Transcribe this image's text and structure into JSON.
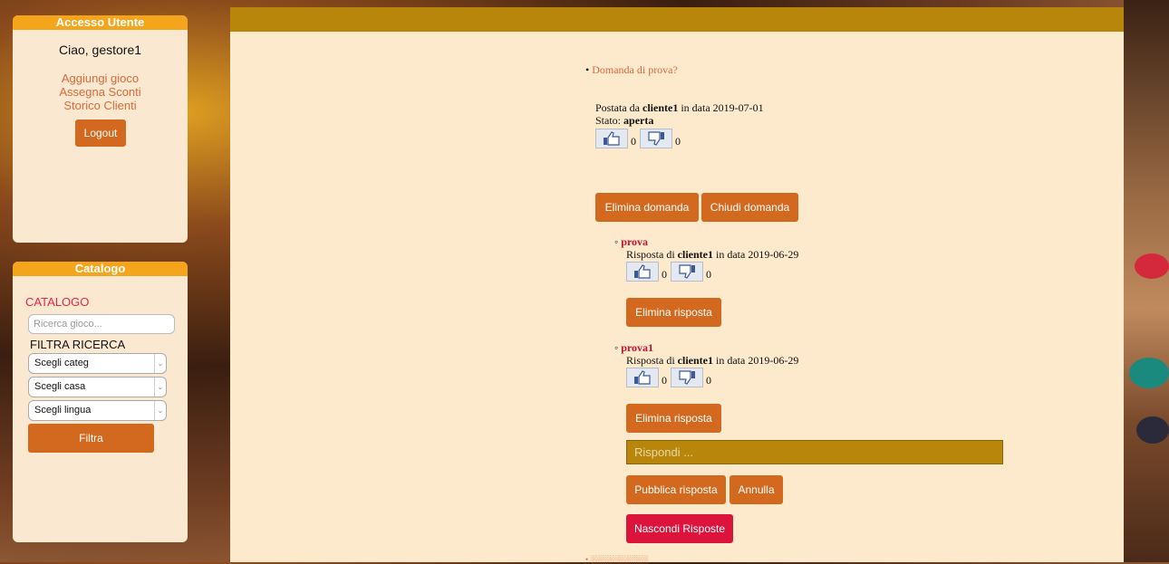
{
  "user_panel": {
    "header": "Accesso Utente",
    "greeting": "Ciao, gestore1",
    "links": [
      "Aggiungi gioco",
      "Assegna Sconti",
      "Storico Clienti"
    ],
    "logout": "Logout"
  },
  "catalog_panel": {
    "header": "Catalogo",
    "title": "CATALOGO",
    "search_placeholder": "Ricerca gioco...",
    "filter_title": "FILTRA RICERCA",
    "selects": [
      "Scegli categ",
      "Scegli casa",
      "Scegli lingua"
    ],
    "filter_button": "Filtra"
  },
  "question": {
    "title": "Domanda di prova?",
    "posted_prefix": "Postata da ",
    "author": "cliente1",
    "date_text": " in data 2019-07-01",
    "status_label": "Stato: ",
    "status": "aperta",
    "likes": "0",
    "dislikes": "0",
    "delete_button": "Elimina domanda",
    "close_button": "Chiudi domanda"
  },
  "answers": [
    {
      "title": "prova",
      "reply_prefix": "Risposta di ",
      "author": "cliente1",
      "date_text": " in data 2019-06-29",
      "likes": "0",
      "dislikes": "0",
      "delete_button": "Elimina risposta"
    },
    {
      "title": "prova1",
      "reply_prefix": "Risposta di ",
      "author": "cliente1",
      "date_text": " in data 2019-06-29",
      "likes": "0",
      "dislikes": "0",
      "delete_button": "Elimina risposta"
    }
  ],
  "reply": {
    "placeholder": "Rispondi ...",
    "publish_button": "Pubblica risposta",
    "cancel_button": "Annulla",
    "hide_button": "Nascondi Risposte"
  },
  "colors": {
    "accent": "#d2691e",
    "header_bar": "#b8860b",
    "panel_header": "#f5a51c",
    "danger": "#dc143c"
  }
}
